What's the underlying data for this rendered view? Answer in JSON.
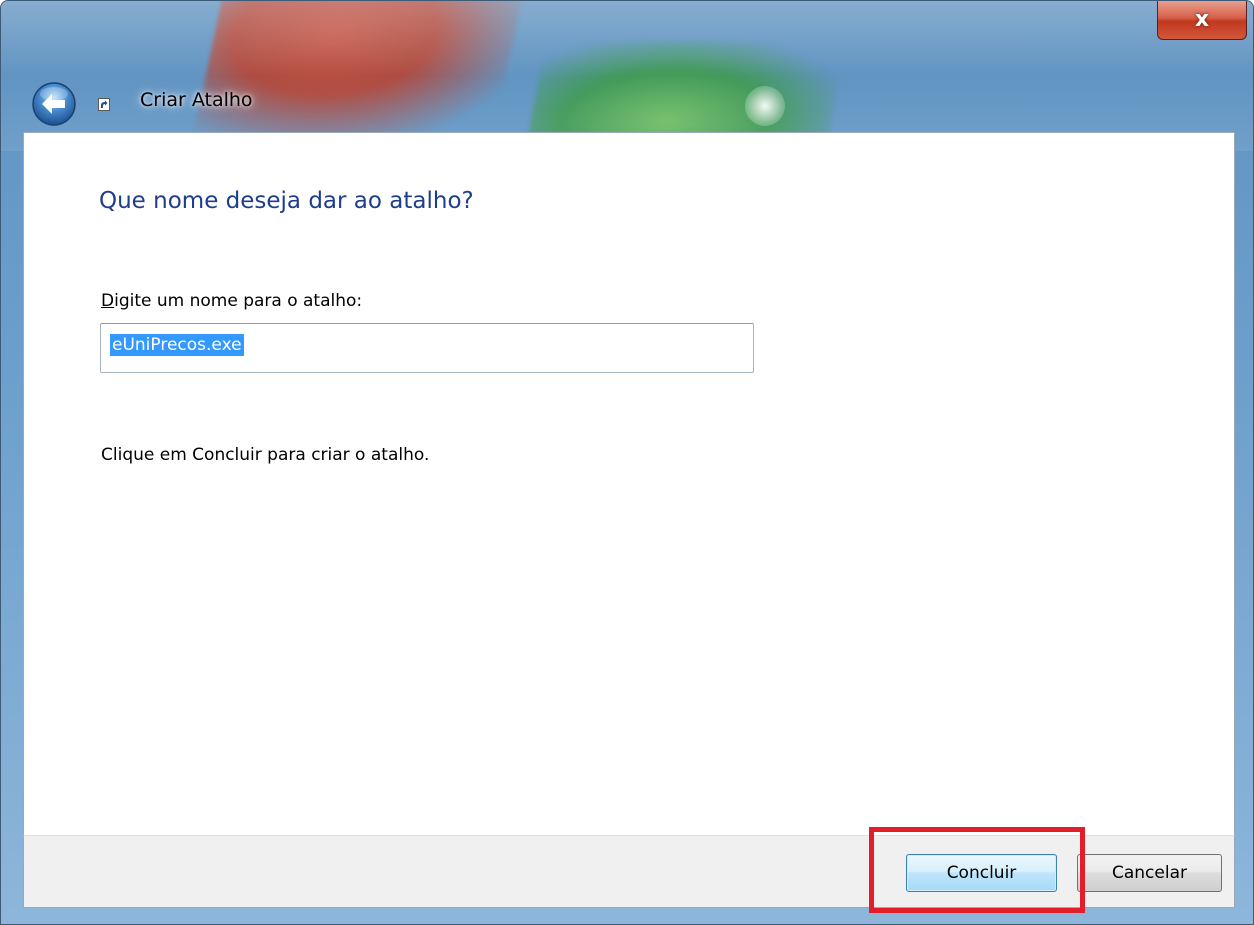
{
  "window": {
    "title": "Criar Atalho",
    "close_label": "x"
  },
  "main": {
    "heading": "Que nome deseja dar ao atalho?",
    "field_label_mnemonic": "D",
    "field_label_rest": "igite um nome para o atalho:",
    "name_value": "eUniPrecos.exe",
    "instruction": "Clique em Concluir para criar o atalho."
  },
  "footer": {
    "finish_label": "Concluir",
    "cancel_label": "Cancelar"
  },
  "icons": {
    "back": "back-arrow-icon",
    "shortcut": "shortcut-icon",
    "close": "close-icon"
  },
  "colors": {
    "heading": "#1e3d8c",
    "selection": "#3399ff",
    "annotation": "#e21e2b",
    "close_button": "#c0391f"
  }
}
